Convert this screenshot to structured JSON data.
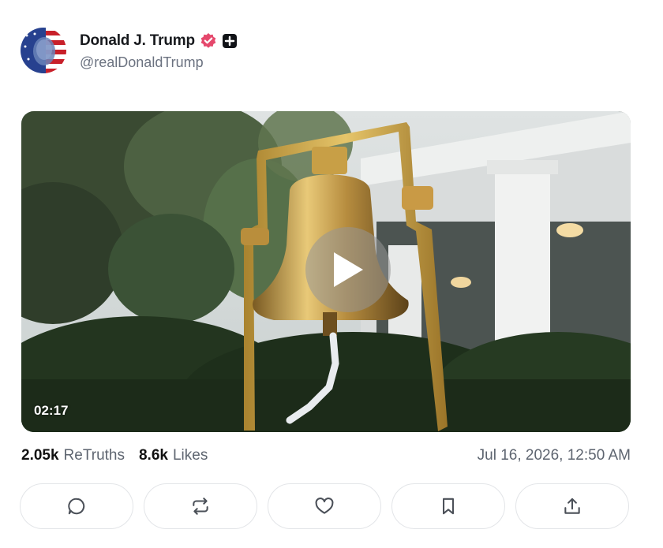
{
  "post": {
    "author": {
      "display_name": "Donald J. Trump",
      "handle": "@realDonaldTrump",
      "avatar_icon": "flag-portrait-avatar",
      "verified_icon": "verified-badge-icon",
      "verified_color": "#e5486c"
    },
    "video": {
      "duration": "02:17",
      "play_icon": "play-icon"
    },
    "stats": {
      "retruths_count": "2.05k",
      "retruths_label": "ReTruths",
      "likes_count": "8.6k",
      "likes_label": "Likes"
    },
    "timestamp": "Jul 16, 2026, 12:50 AM"
  },
  "actions": [
    {
      "icon": "reply-icon"
    },
    {
      "icon": "retruth-icon"
    },
    {
      "icon": "like-icon"
    },
    {
      "icon": "bookmark-icon"
    },
    {
      "icon": "share-icon"
    }
  ]
}
